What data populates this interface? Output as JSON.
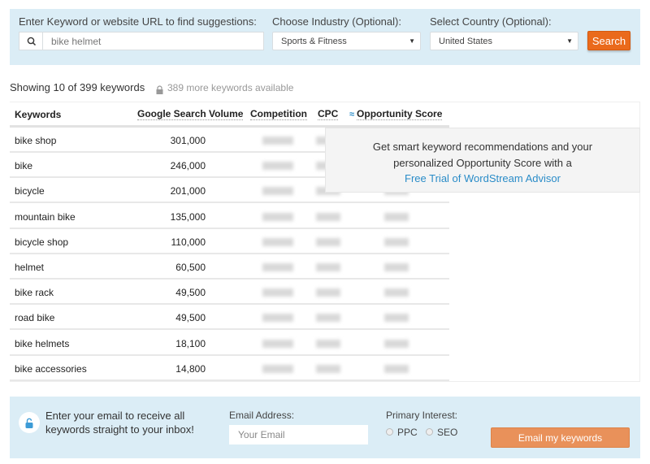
{
  "search": {
    "keyword_label": "Enter Keyword or website URL to find suggestions:",
    "keyword_value": "bike helmet",
    "industry_label": "Choose Industry (Optional):",
    "industry_value": "Sports & Fitness",
    "country_label": "Select Country (Optional):",
    "country_value": "United States",
    "search_button": "Search",
    "accent_color": "#ea6a1c"
  },
  "results": {
    "showing": "Showing 10 of 399 keywords",
    "more": "389 more keywords available",
    "columns": [
      "Keywords",
      "Google Search Volume",
      "Competition",
      "CPC",
      "Opportunity Score"
    ],
    "rows": [
      {
        "keyword": "bike shop",
        "volume": "301,000"
      },
      {
        "keyword": "bike",
        "volume": "246,000"
      },
      {
        "keyword": "bicycle",
        "volume": "201,000"
      },
      {
        "keyword": "mountain bike",
        "volume": "135,000"
      },
      {
        "keyword": "bicycle shop",
        "volume": "110,000"
      },
      {
        "keyword": "helmet",
        "volume": "60,500"
      },
      {
        "keyword": "bike rack",
        "volume": "49,500"
      },
      {
        "keyword": "road bike",
        "volume": "49,500"
      },
      {
        "keyword": "bike helmets",
        "volume": "18,100"
      },
      {
        "keyword": "bike accessories",
        "volume": "14,800"
      }
    ]
  },
  "promo": {
    "line1": "Get smart keyword recommendations and your",
    "line2": "personalized Opportunity Score with a",
    "link": "Free Trial of WordStream Advisor"
  },
  "email": {
    "text_line1": "Enter your email to receive all",
    "text_line2": "keywords straight to your inbox!",
    "address_label": "Email Address:",
    "placeholder": "Your Email",
    "interest_label": "Primary Interest:",
    "options": [
      "PPC",
      "SEO"
    ],
    "button": "Email my keywords"
  }
}
